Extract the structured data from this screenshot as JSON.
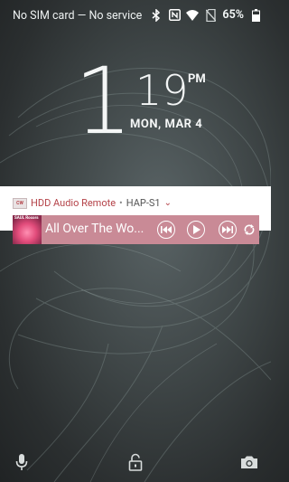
{
  "status_bar": {
    "carrier_text": "No SIM card — No service",
    "battery": "65%",
    "icons": [
      "bluetooth-icon",
      "nfc-icon",
      "wifi-icon",
      "no-sim-icon",
      "battery-icon"
    ]
  },
  "clock": {
    "hour": "1",
    "minutes": "19",
    "ampm": "PM",
    "date": "MON, MAR 4"
  },
  "notification": {
    "app_name": "HDD Audio Remote",
    "separator": "•",
    "device": "HAP-S1",
    "track_title": "All Over The Wo...",
    "album_text": "SAUL Rocors",
    "controls": [
      "previous-icon",
      "play-icon",
      "next-icon",
      "repeat-icon"
    ],
    "accent_color": "#b44248",
    "player_color": "#c98a96"
  },
  "bottom": {
    "icons": [
      "microphone-icon",
      "lock-icon",
      "camera-icon"
    ]
  }
}
